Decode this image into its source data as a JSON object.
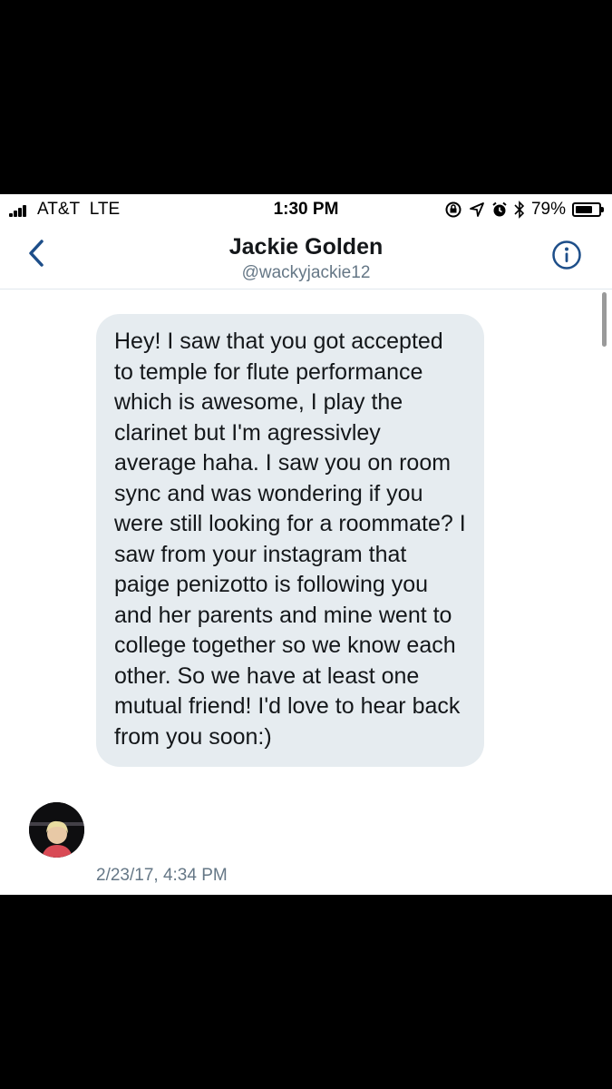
{
  "status_bar": {
    "carrier": "AT&T",
    "network": "LTE",
    "time": "1:30 PM",
    "battery": "79%",
    "battery_level": 0.79
  },
  "header": {
    "name": "Jackie Golden",
    "handle": "@wackyjackie12"
  },
  "message": {
    "text": "Hey! I saw that you got accepted to temple for  flute performance which is awesome, I play the clarinet but I'm agressivley average haha. I saw you on room sync and was wondering if you were still looking for a roommate? I saw from your instagram that paige penizotto is following you and her parents and mine went to college together so we know each other. So we have at least one mutual friend! I'd love to hear back from you soon:)",
    "timestamp": "2/23/17, 4:34 PM"
  },
  "colors": {
    "accent": "#1d4e89",
    "bubble": "#e6ecf0",
    "secondary_text": "#657786"
  },
  "icons": [
    "signal-icon",
    "orientation-lock-icon",
    "location-icon",
    "alarm-icon",
    "bluetooth-icon",
    "battery-icon",
    "back-chevron-icon",
    "info-icon"
  ]
}
